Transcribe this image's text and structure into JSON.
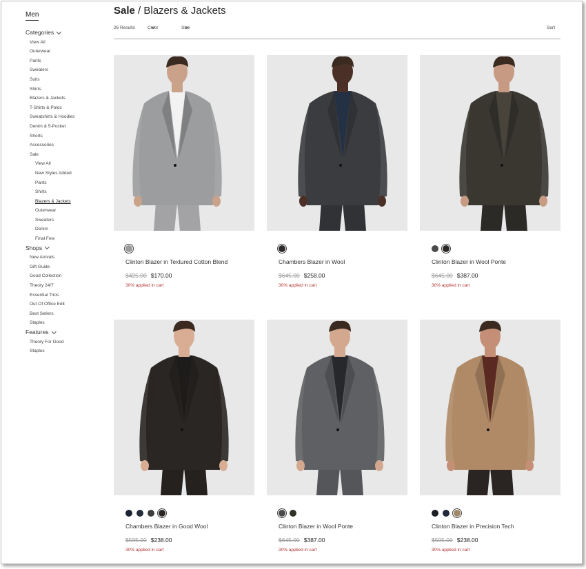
{
  "sidebar": {
    "heading": "Men",
    "categories_label": "Categories",
    "categories": [
      "View All",
      "Outerwear",
      "Pants",
      "Sweaters",
      "Suits",
      "Shirts",
      "Blazers & Jackets",
      "T-Shirts & Polos",
      "Sweatshirts & Hoodies",
      "Denim & 5-Pocket",
      "Shorts",
      "Accessories",
      "Sale"
    ],
    "sale_items": [
      "View All",
      "New Styles Added",
      "Pants",
      "Shirts",
      "Blazers & Jackets",
      "Outerwear",
      "Sweaters",
      "Denim",
      "Final Few"
    ],
    "active_sale_item": "Blazers & Jackets",
    "shops_label": "Shops",
    "shops": [
      "New Arrivals",
      "Gift Guide",
      "Good Collection",
      "Theory 24/7",
      "Essential Trios",
      "Out Of Office Edit",
      "Best Sellers",
      "Staples"
    ],
    "features_label": "Features",
    "features": [
      "Theory For Good",
      "Staples"
    ]
  },
  "header": {
    "title_bold": "Sale",
    "title_sep": " / ",
    "title_rest": "Blazers & Jackets",
    "results": "26 Results",
    "color_filter": "Color",
    "size_filter": "Size",
    "sort": "Sort"
  },
  "products": [
    {
      "name": "Clinton Blazer in Textured Cotton Blend",
      "original_price": "$425.00",
      "sale_price": "$170.00",
      "promo": "30% applied in cart",
      "swatches": [
        "#9a9a9a"
      ],
      "selected_swatch": 0,
      "jacket": "#9c9d9f",
      "shirt": "#f2f2f2",
      "skin": "#caa289",
      "pants": "#a3a3a5"
    },
    {
      "name": "Chambers Blazer in Wool",
      "original_price": "$645.00",
      "sale_price": "$258.00",
      "promo": "30% applied in cart",
      "swatches": [
        "#2f2a2a"
      ],
      "selected_swatch": 0,
      "jacket": "#3b3c40",
      "shirt": "#243044",
      "skin": "#4a3026",
      "pants": "#303236"
    },
    {
      "name": "Clinton Blazer in Wool Ponte",
      "original_price": "$645.00",
      "sale_price": "$387.00",
      "promo": "30% applied in cart",
      "swatches": [
        "#4a4a4a",
        "#2b2826"
      ],
      "selected_swatch": 1,
      "jacket": "#3a3731",
      "shirt": "#48443c",
      "skin": "#c79a84",
      "pants": "#2c2a27"
    },
    {
      "name": "Chambers Blazer in Good Wool",
      "original_price": "$595.00",
      "sale_price": "$238.00",
      "promo": "30% applied in cart",
      "swatches": [
        "#1c2433",
        "#232a3a",
        "#3c3c3c",
        "#2a2522"
      ],
      "selected_swatch": 3,
      "jacket": "#2a2624",
      "shirt": "#1e1c1b",
      "skin": "#d8ad94",
      "pants": "#24211f"
    },
    {
      "name": "Clinton Blazer in Wool Ponte",
      "original_price": "$645.00",
      "sale_price": "$387.00",
      "promo": "30% applied in cart",
      "swatches": [
        "#4a4a4a",
        "#2f3326"
      ],
      "selected_swatch": 0,
      "jacket": "#5f6063",
      "shirt": "#26282c",
      "skin": "#d3a88e",
      "pants": "#55565a"
    },
    {
      "name": "Clinton Blazer in Precision Tech",
      "original_price": "$595.00",
      "sale_price": "$238.00",
      "promo": "30% applied in cart",
      "swatches": [
        "#1c1f26",
        "#22283a",
        "#a08766"
      ],
      "selected_swatch": 2,
      "jacket": "#b08a66",
      "shirt": "#5a2a22",
      "skin": "#c48f76",
      "pants": "#2a2422"
    }
  ]
}
